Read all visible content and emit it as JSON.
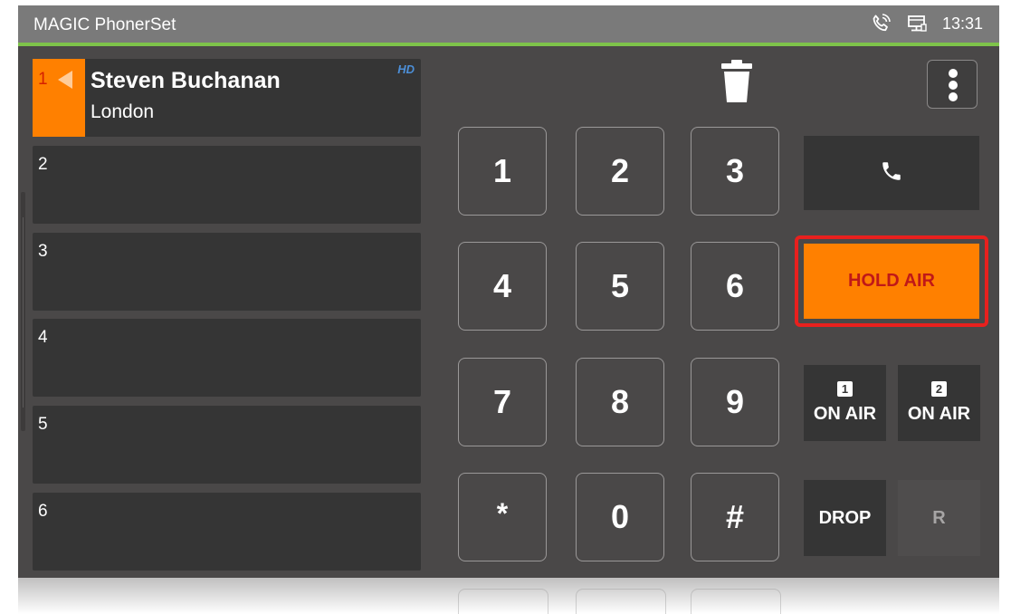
{
  "app": {
    "title": "MAGIC PhonerSet",
    "time": "13:31",
    "icons": [
      "phone-ringing-icon",
      "network-monitor-icon"
    ]
  },
  "lines": [
    {
      "number": "1",
      "name": "Steven Buchanan",
      "city": "London",
      "badge": "HD",
      "active": true
    },
    {
      "number": "2",
      "name": "",
      "city": "",
      "badge": "",
      "active": false
    },
    {
      "number": "3",
      "name": "",
      "city": "",
      "badge": "",
      "active": false
    },
    {
      "number": "4",
      "name": "",
      "city": "",
      "badge": "",
      "active": false
    },
    {
      "number": "5",
      "name": "",
      "city": "",
      "badge": "",
      "active": false
    },
    {
      "number": "6",
      "name": "",
      "city": "",
      "badge": "",
      "active": false
    }
  ],
  "keypad": [
    "1",
    "2",
    "3",
    "4",
    "5",
    "6",
    "7",
    "8",
    "9",
    "*",
    "0",
    "#"
  ],
  "actions": {
    "call_icon": "phone-icon",
    "hold_air": "HOLD AIR",
    "onair1_badge": "1",
    "onair1_label": "ON AIR",
    "onair2_badge": "2",
    "onair2_label": "ON AIR",
    "drop": "DROP",
    "r": "R"
  },
  "colors": {
    "accent_orange": "#ff8000",
    "status_green": "#7ec34a",
    "hd_blue": "#4c8fd8",
    "highlight_red": "#e8201e"
  }
}
